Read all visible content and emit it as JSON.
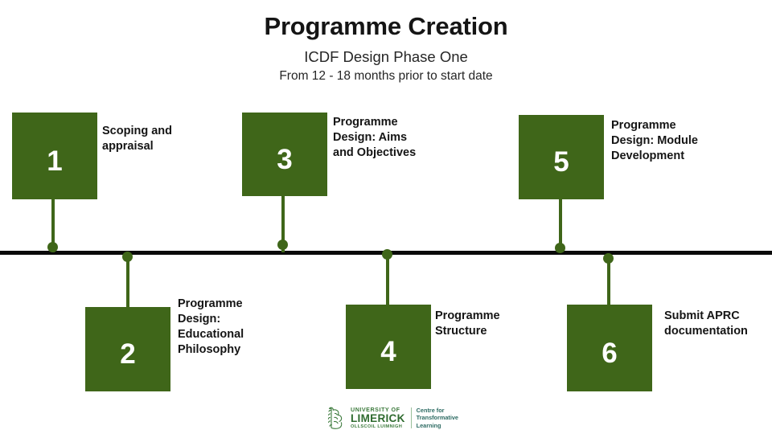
{
  "header": {
    "title": "Programme Creation",
    "subtitle": "ICDF Design Phase One",
    "subtitle2": "From 12 - 18 months prior to start date"
  },
  "theme": {
    "box_green": "#3f6619",
    "axis_black": "#0a0a0a",
    "text_black": "#151515",
    "logo_green": "#2f6b2f",
    "logo_teal": "#2d6b63"
  },
  "timeline": {
    "milestones": [
      {
        "number": "1",
        "label": "Scoping and\nappraisal",
        "position": "above"
      },
      {
        "number": "2",
        "label": "Programme\nDesign:\nEducational\nPhilosophy",
        "position": "below"
      },
      {
        "number": "3",
        "label": "Programme\nDesign: Aims\nand Objectives",
        "position": "above"
      },
      {
        "number": "4",
        "label": "Programme\nStructure",
        "position": "below"
      },
      {
        "number": "5",
        "label": "Programme\nDesign: Module\nDevelopment",
        "position": "above"
      },
      {
        "number": "6",
        "label": "Submit APRC\ndocumentation",
        "position": "below"
      }
    ]
  },
  "footer": {
    "university": {
      "line1": "UNIVERSITY OF",
      "line2": "LIMERICK",
      "line3": "OLLSCOIL LUIMNIGH"
    },
    "centre": {
      "line1": "Centre for",
      "line2": "Transformative",
      "line3": "Learning"
    }
  }
}
